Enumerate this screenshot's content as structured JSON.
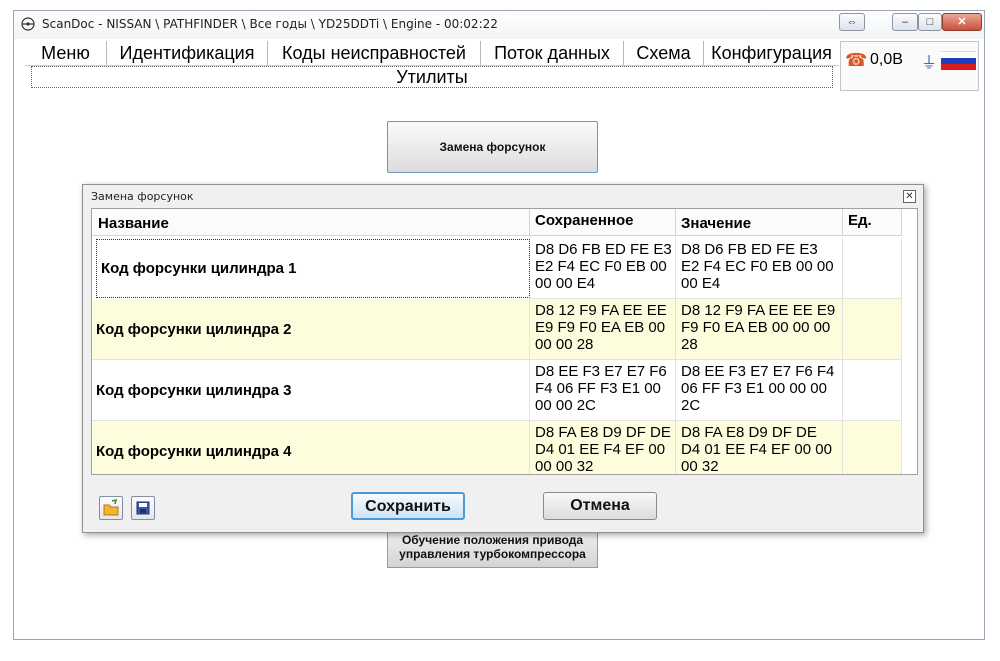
{
  "window": {
    "title": "ScanDoc - NISSAN \\ PATHFINDER \\ Все годы \\ YD25DDTi \\ Engine - 00:02:22"
  },
  "menu": {
    "items": [
      "Меню",
      "Идентификация",
      "Коды неисправностей",
      "Поток данных",
      "Схема",
      "Конфигурация"
    ],
    "active_subtab": "Утилиты"
  },
  "status": {
    "voltage": "0,0В",
    "phone_icon": "phone-icon",
    "plug_icon": "plug-icon",
    "flag_colors": [
      "#ffffff",
      "#1f3fbf",
      "#e01a1a"
    ]
  },
  "main": {
    "injector_button": "Замена форсунок",
    "turbo_button_line1": "Обучение положения привода",
    "turbo_button_line2": "управления турбокомпрессора"
  },
  "dialog": {
    "title": "Замена форсунок",
    "columns": [
      "Название",
      "Сохраненное",
      "Значение",
      "Ед."
    ],
    "rows": [
      {
        "name": "Код форсунки цилиндра 1",
        "saved": "D8 D6 FB ED FE E3 E2 F4 EC F0 EB 00 00 00 E4",
        "value": "D8 D6 FB ED FE E3 E2 F4 EC F0 EB 00 00 00 E4",
        "unit": ""
      },
      {
        "name": "Код форсунки цилиндра 2",
        "saved": "D8 12 F9 FA EE EE E9 F9 F0 EA EB 00 00 00 28",
        "value": "D8 12 F9 FA EE EE E9 F9 F0 EA EB 00 00 00 28",
        "unit": ""
      },
      {
        "name": "Код форсунки цилиндра 3",
        "saved": "D8 EE F3 E7 E7 F6 F4 06 FF F3 E1 00 00 00 2C",
        "value": "D8 EE F3 E7 E7 F6 F4 06 FF F3 E1 00 00 00 2C",
        "unit": ""
      },
      {
        "name": "Код форсунки цилиндра 4",
        "saved": "D8 FA E8 D9 DF DE D4 01 EE F4 EF 00 00 00 32",
        "value": "D8 FA E8 D9 DF DE D4 01 EE F4 EF 00 00 00 32",
        "unit": ""
      }
    ],
    "save_label": "Сохранить",
    "cancel_label": "Отмена",
    "row_alt_color": "#fdfdde",
    "save_accent": "#4a9ad8"
  }
}
